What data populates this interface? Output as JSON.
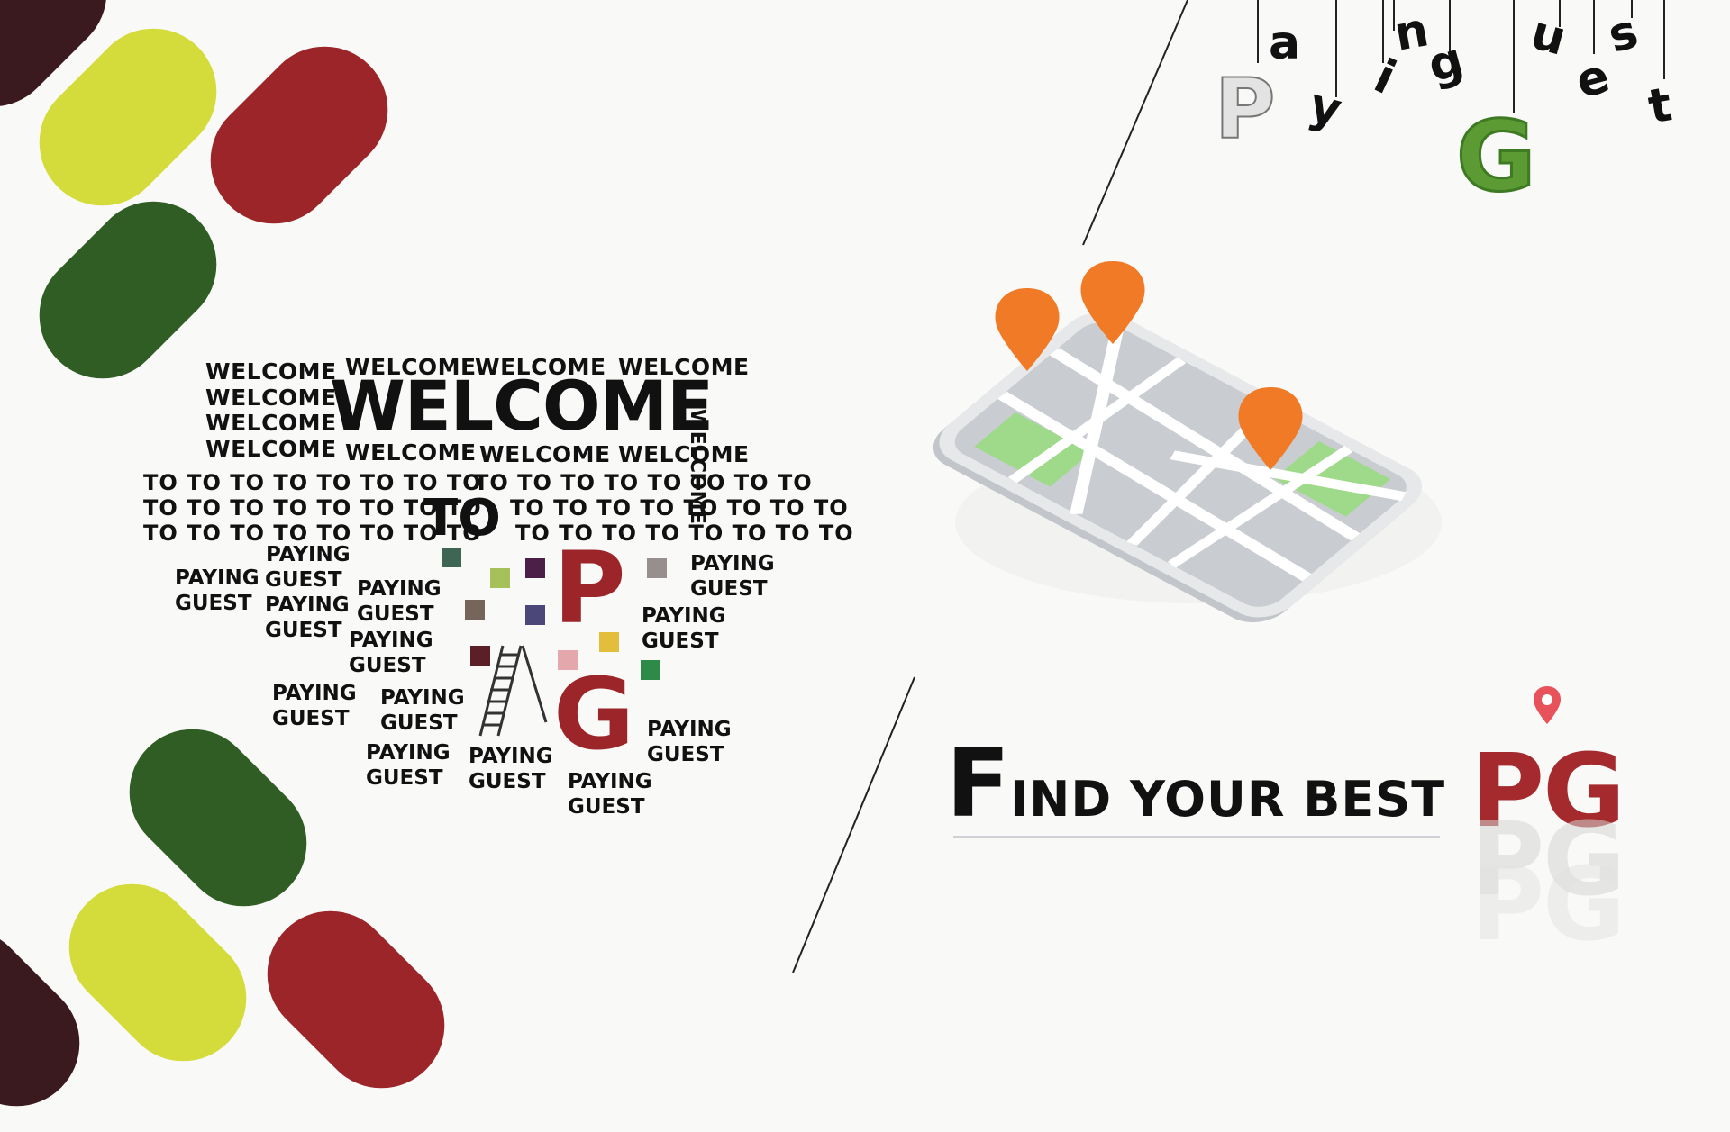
{
  "colors": {
    "yellow": "#d4dc3c",
    "red": "#9b2528",
    "green": "#2f5d23",
    "maroon": "#3a1a1e",
    "accent_red": "#a52a2e",
    "pin_orange": "#f07a26",
    "map_green": "#9fd98a"
  },
  "word_cloud": {
    "welcome_big": "WELCOME",
    "welcome_small": "WELCOME",
    "to_big": "TO",
    "to_row": "TO TO TO TO TO TO TO TO",
    "to_row_long": "TO TO TO TO TO TO TO TO",
    "paying": "PAYING",
    "guest": "GUEST",
    "letter_p": "P",
    "letter_g": "G"
  },
  "header_logo": {
    "letters": [
      "P",
      "a",
      "y",
      "i",
      "n",
      "g",
      "u",
      "e",
      "s",
      "t",
      "G"
    ]
  },
  "tagline": {
    "first_letter": "F",
    "rest": "IND YOUR BEST",
    "brand": "PG"
  },
  "icons": {
    "map": "map-with-pins-icon",
    "location_pin": "location-pin-icon",
    "ladder": "ladder-icon"
  }
}
